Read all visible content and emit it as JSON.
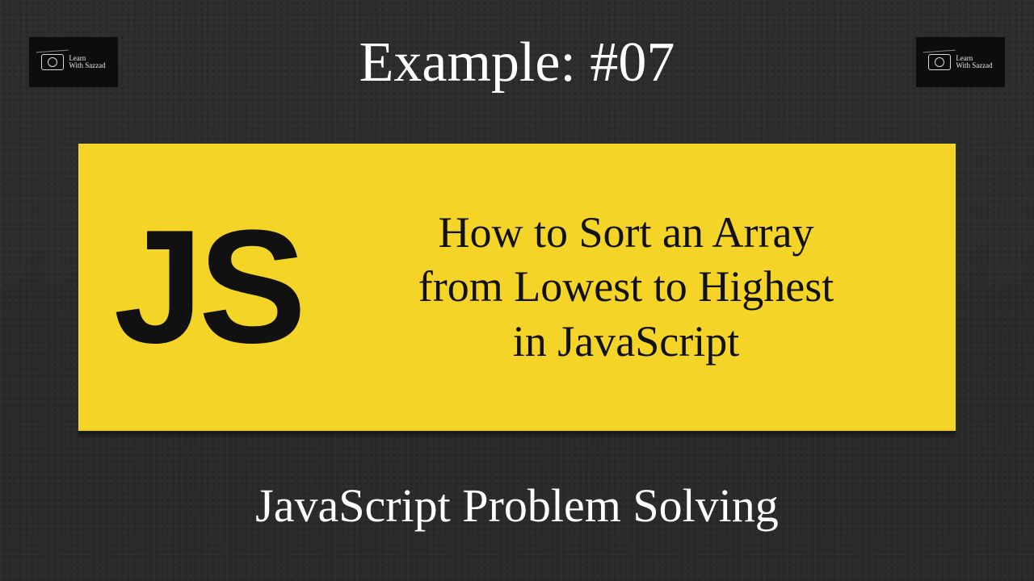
{
  "logo": {
    "line1": "Learn",
    "line2": "With Sazzad"
  },
  "top_title": "Example: #07",
  "banner": {
    "js_mark": "JS",
    "title_line1": "How to Sort an Array",
    "title_line2": "from Lowest to Highest",
    "title_line3": "in JavaScript"
  },
  "subtitle": "JavaScript Problem Solving",
  "colors": {
    "background": "#2f2f2f",
    "banner": "#f4d427",
    "text_light": "#ffffff",
    "text_dark": "#111111"
  }
}
